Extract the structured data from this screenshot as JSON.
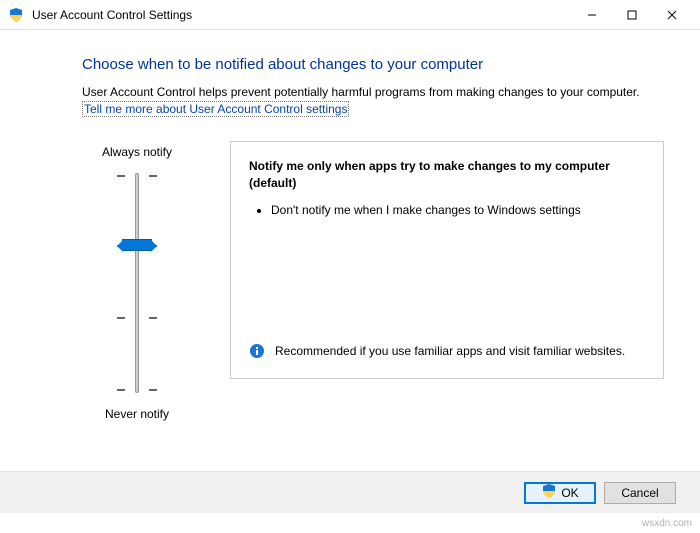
{
  "window": {
    "title": "User Account Control Settings"
  },
  "heading": "Choose when to be notified about changes to your computer",
  "description": "User Account Control helps prevent potentially harmful programs from making changes to your computer.",
  "help_link": "Tell me more about User Account Control settings",
  "slider": {
    "top_label": "Always notify",
    "bottom_label": "Never notify",
    "levels": 4,
    "selected_index": 1
  },
  "setting": {
    "title": "Notify me only when apps try to make changes to my computer (default)",
    "bullets": [
      "Don't notify me when I make changes to Windows settings"
    ],
    "recommendation": "Recommended if you use familiar apps and visit familiar websites."
  },
  "buttons": {
    "ok": "OK",
    "cancel": "Cancel"
  },
  "watermark": "wsxdn.com"
}
